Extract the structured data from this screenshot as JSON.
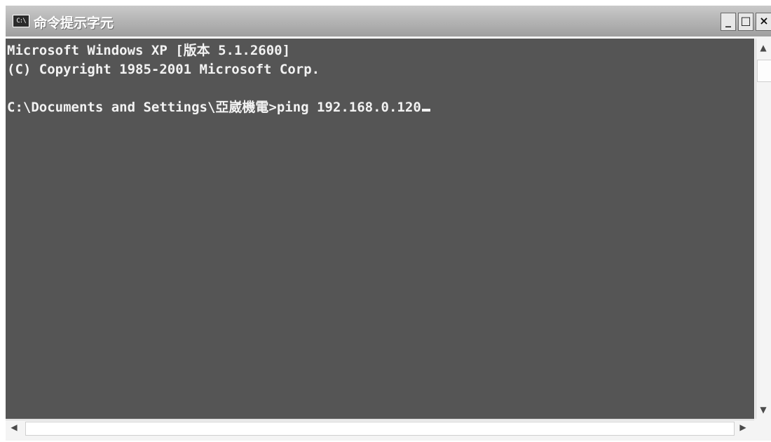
{
  "window": {
    "title": "命令提示字元",
    "icon": "cmd-icon",
    "icon_text": "C:\\",
    "controls": {
      "minimize": "_",
      "maximize": "□",
      "close": "×"
    }
  },
  "console": {
    "lines": [
      "Microsoft Windows XP [版本 5.1.2600]",
      "(C) Copyright 1985-2001 Microsoft Corp.",
      "C:\\Documents and Settings\\亞崴機電>ping 192.168.0.120"
    ],
    "text_color": "#f2f2f2",
    "background": "#555555"
  },
  "scrollbars": {
    "up": "▲",
    "down": "▼",
    "left": "◀",
    "right": "▶"
  }
}
